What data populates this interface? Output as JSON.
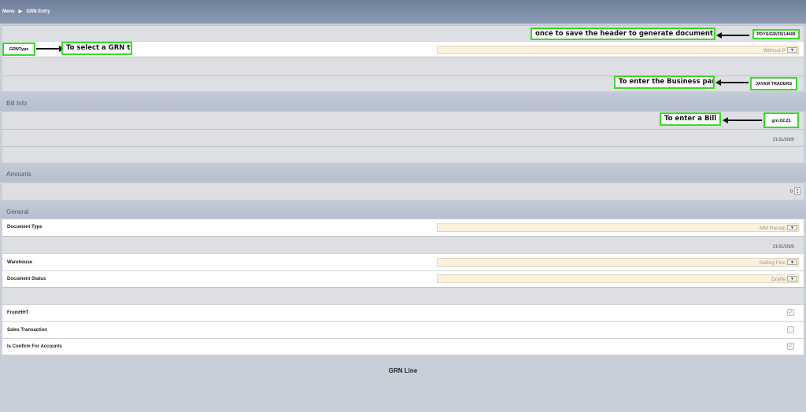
{
  "breadcrumb": {
    "menu": "Menu",
    "separator": "▶",
    "page": "GRN Entry"
  },
  "header": {
    "document_no": "PDYS/GR/25/14409",
    "grn_type_label": "GRNType",
    "grn_type_value": "Without P",
    "business_partner": "JAYAM TRADERS"
  },
  "bill_info": {
    "title": "Bill Info",
    "bill_no": "grn.02.21",
    "bill_date": "21/11/2025"
  },
  "amounts": {
    "title": "Amounts",
    "value": "0"
  },
  "general": {
    "title": "General",
    "document_type_label": "Document Type",
    "document_type_value": "MM Receip",
    "date_value": "21/11/2025",
    "warehouse_label": "Warehouse",
    "warehouse_value": "Selling Floc",
    "document_status_label": "Document Status",
    "document_status_value": "Drafte"
  },
  "flags": {
    "from_hht_label": "FromHHT",
    "from_hht_checked": true,
    "sales_transaction_label": "Sales Transaction",
    "sales_transaction_checked": false,
    "confirm_accounts_label": "Is Confirm For Accounts",
    "confirm_accounts_checked": true
  },
  "annotations": {
    "save_header": "once to save the header to generate document no",
    "select_grn_type": "To select a GRN type",
    "business_partner": "To enter the Business partner",
    "bill_no": "To enter a Bill no"
  },
  "grn_line_title": "GRN Line",
  "colors": {
    "highlight_border": "#3adb2a",
    "section_text": "#4c5873",
    "combo_bg": "#fbf1dc"
  },
  "icons": {
    "dropdown": "chevron-down-icon",
    "checkbox": "check-icon",
    "spinner": "spinner-icon"
  }
}
